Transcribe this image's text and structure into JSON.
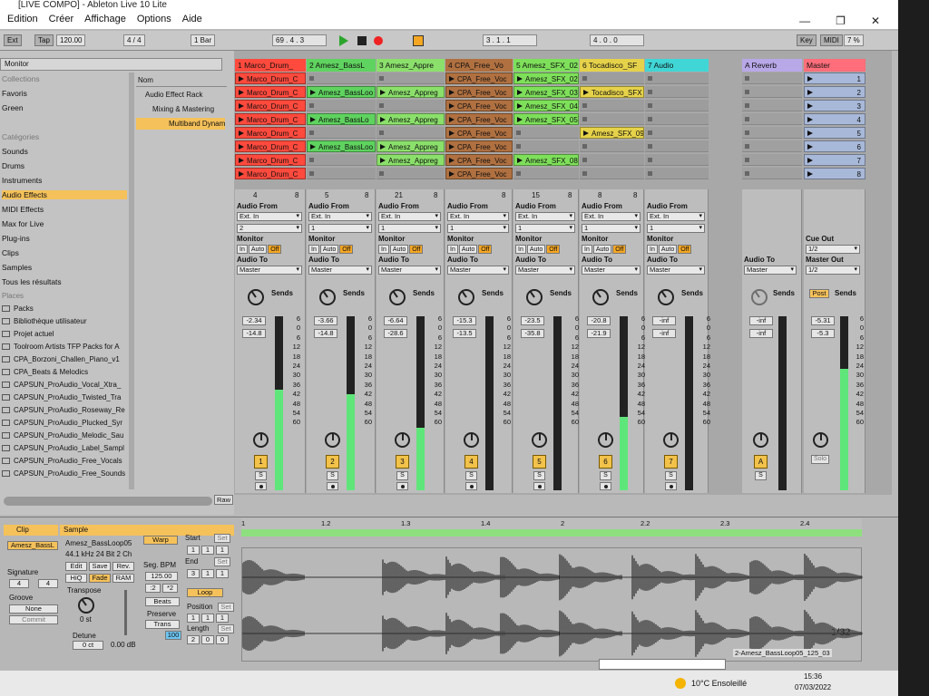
{
  "window": {
    "title": "[LIVE COMPO] - Ableton Live 10 Lite",
    "menu": [
      "Edition",
      "Créer",
      "Affichage",
      "Options",
      "Aide"
    ]
  },
  "transport": {
    "ext": "Ext",
    "tap": "Tap",
    "bpm": "120.00",
    "signature": "4 / 4",
    "quant": "1 Bar",
    "position": "69 . 4 . 3",
    "loop_start": "3 . 1 . 1",
    "loop_len": "4 . 0 . 0",
    "key": "Key",
    "midi": "MIDI",
    "cpu": "7 %"
  },
  "browser": {
    "header": "Monitor",
    "categories": [
      {
        "label": "Collections",
        "selected": false
      },
      {
        "label": "Favoris",
        "selected": false
      },
      {
        "label": "Green",
        "selected": false
      },
      {
        "label": "Catégories",
        "selected": false
      },
      {
        "label": "Sounds",
        "selected": false
      },
      {
        "label": "Drums",
        "selected": false
      },
      {
        "label": "Instruments",
        "selected": false
      },
      {
        "label": "Audio Effects",
        "selected": true
      },
      {
        "label": "MIDI Effects",
        "selected": false
      },
      {
        "label": "Max for Live",
        "selected": false
      },
      {
        "label": "Plug-ins",
        "selected": false
      },
      {
        "label": "Clips",
        "selected": false
      },
      {
        "label": "Samples",
        "selected": false
      },
      {
        "label": "Tous les résultats",
        "selected": false
      }
    ],
    "places_header": "Places",
    "places": [
      "Packs",
      "Bibliothèque utilisateur",
      "Projet actuel",
      "Toolroom Artists TFP Packs for A",
      "CPA_Borzoni_Challen_Piano_v1",
      "CPA_Beats & Melodics",
      "CAPSUN_ProAudio_Vocal_Xtra_",
      "CAPSUN_ProAudio_Twisted_Tra",
      "CAPSUN_ProAudio_Roseway_Re",
      "CAPSUN_ProAudio_Plucked_Syr",
      "CAPSUN_ProAudio_Melodic_Sau",
      "CAPSUN_ProAudio_Label_Sampl",
      "CAPSUN_ProAudio_Free_Vocals",
      "CAPSUN_ProAudio_Free_Sounds"
    ],
    "name_header": "Nom",
    "tree": [
      "Audio Effect Rack",
      "Mixing & Mastering",
      "Multiband Dynamics"
    ],
    "raw": "Raw"
  },
  "tracks": [
    {
      "name": "1 Marco_Drum_",
      "color": "#ff4a3d",
      "num": "1",
      "in": "4",
      "out": "8",
      "vol": "-2.34",
      "peak": "-14.8",
      "level": 0.58,
      "clips": [
        "Marco_Drum_C",
        "Marco_Drum_C",
        "Marco_Drum_C",
        "Marco_Drum_C",
        "Marco_Drum_C",
        "Marco_Drum_C",
        "Marco_Drum_C",
        "Marco_Drum_C"
      ],
      "from": "Ext. In",
      "chan": "2",
      "to": "Master"
    },
    {
      "name": "2 Amesz_BassL",
      "color": "#5fd35f",
      "num": "2",
      "in": "5",
      "out": "8",
      "vol": "-3.66",
      "peak": "-14.8",
      "level": 0.55,
      "clips": [
        "",
        "Amesz_BassLoo",
        "",
        "Amesz_BassLo",
        "",
        "Amesz_BassLoo",
        "",
        ""
      ],
      "from": "Ext. In",
      "chan": "1",
      "to": "Master"
    },
    {
      "name": "3 Amesz_Appre",
      "color": "#8be06b",
      "num": "3",
      "in": "21",
      "out": "8",
      "vol": "-6.64",
      "peak": "-28.6",
      "level": 0.36,
      "clips": [
        "",
        "Amesz_Appreg",
        "",
        "Amesz_Appreg",
        "",
        "Amesz_Appreg",
        "Amesz_Appreg",
        ""
      ],
      "from": "Ext. In",
      "chan": "1",
      "to": "Master"
    },
    {
      "name": "4 CPA_Free_Vo",
      "color": "#b07040",
      "num": "4",
      "in": "",
      "out": "8",
      "vol": "-15.3",
      "peak": "-13.5",
      "level": 0.0,
      "clips": [
        "CPA_Free_Voc",
        "CPA_Free_Voc",
        "CPA_Free_Voc",
        "CPA_Free_Voc",
        "CPA_Free_Voc",
        "CPA_Free_Voc",
        "CPA_Free_Voc",
        "CPA_Free_Voc"
      ],
      "from": "Ext. In",
      "chan": "1",
      "to": "Master"
    },
    {
      "name": "5 Amesz_SFX_02",
      "color": "#7ee05a",
      "num": "5",
      "in": "15",
      "out": "8",
      "vol": "-23.5",
      "peak": "-35.8",
      "level": 0.0,
      "clips": [
        "Amesz_SFX_02",
        "Amesz_SFX_03",
        "Amesz_SFX_04",
        "Amesz_SFX_05",
        "",
        "",
        "Amesz_SFX_08",
        ""
      ],
      "from": "Ext. In",
      "chan": "1",
      "to": "Master"
    },
    {
      "name": "6 Tocadisco_SF",
      "color": "#e6d24a",
      "num": "6",
      "in": "8",
      "out": "8",
      "vol": "-20.8",
      "peak": "-21.9",
      "level": 0.42,
      "clips": [
        "",
        "Tocadisco_SFX",
        "",
        "",
        "Amesz_SFX_09",
        "",
        "",
        ""
      ],
      "from": "Ext. In",
      "chan": "1",
      "to": "Master"
    },
    {
      "name": "7 Audio",
      "color": "#41d6d6",
      "num": "7",
      "in": "",
      "out": "",
      "vol": "-inf",
      "peak": "-inf",
      "level": 0.0,
      "clips": [
        "",
        "",
        "",
        "",
        "",
        "",
        "",
        ""
      ],
      "from": "Ext. In",
      "chan": "1",
      "to": "Master"
    }
  ],
  "returns": {
    "reverb": {
      "name": "A Reverb",
      "color": "#b8a8e8",
      "num": "A",
      "vol": "-inf",
      "peak": "-inf",
      "to": "Master"
    },
    "master": {
      "name": "Master",
      "color": "#ff6e7a",
      "vol": "-5.31",
      "peak": "-5.3",
      "level": 0.7,
      "scenes": [
        "1",
        "2",
        "3",
        "4",
        "5",
        "6",
        "7",
        "8"
      ],
      "cue_out": "1/2",
      "master_out": "1/2",
      "post": "Post",
      "solo": "Solo"
    }
  },
  "labels": {
    "audio_from": "Audio From",
    "monitor": "Monitor",
    "audio_to": "Audio To",
    "sends": "Sends",
    "mon_in": "In",
    "mon_auto": "Auto",
    "mon_off": "Off",
    "solo": "S",
    "cue_out": "Cue Out",
    "master_out": "Master Out",
    "scale": [
      "6",
      "0",
      "6",
      "12",
      "18",
      "24",
      "30",
      "36",
      "42",
      "48",
      "54",
      "60"
    ]
  },
  "clip_view": {
    "clip": "Clip",
    "clip_name": "Amesz_BassL",
    "signature": "Signature",
    "sig_num": "4",
    "sig_den": "4",
    "groove": "Groove",
    "groove_val": "None",
    "commit": "Commit",
    "sample": "Sample",
    "sample_name": "Amesz_BassLoop05",
    "sample_info": "44.1 kHz 24 Bit 2 Ch",
    "edit": "Edit",
    "save": "Save",
    "rev": "Rev.",
    "hiq": "HiQ",
    "fade": "Fade",
    "ram": "RAM",
    "transpose": "Transpose",
    "transpose_val": "0 st",
    "detune": "Detune",
    "detune_val": "0 ct",
    "gain": "0.00 dB",
    "warp": "Warp",
    "seg_bpm": "Seg. BPM",
    "bpm": "125.00",
    "half": ":2",
    "double": "*2",
    "mode": "Beats",
    "preserve": "Preserve",
    "trans": "Trans",
    "amount": "100",
    "start": "Start",
    "start_val": [
      "1",
      "1",
      "1"
    ],
    "end": "End",
    "end_val": [
      "3",
      "1",
      "1"
    ],
    "set": "Set",
    "loop": "Loop",
    "position": "Position",
    "position_val": [
      "1",
      "1",
      "1"
    ],
    "length": "Length",
    "length_val": [
      "2",
      "0",
      "0"
    ],
    "zoom": "1/32",
    "filename": "2-Amesz_BassLoop05_125_03"
  },
  "ruler": [
    "1",
    "1.2",
    "1.3",
    "1.4",
    "2",
    "2.2",
    "2.3",
    "2.4"
  ],
  "taskbar": {
    "weather": "10°C Ensoleillé",
    "time": "15:36",
    "date": "07/03/2022"
  }
}
